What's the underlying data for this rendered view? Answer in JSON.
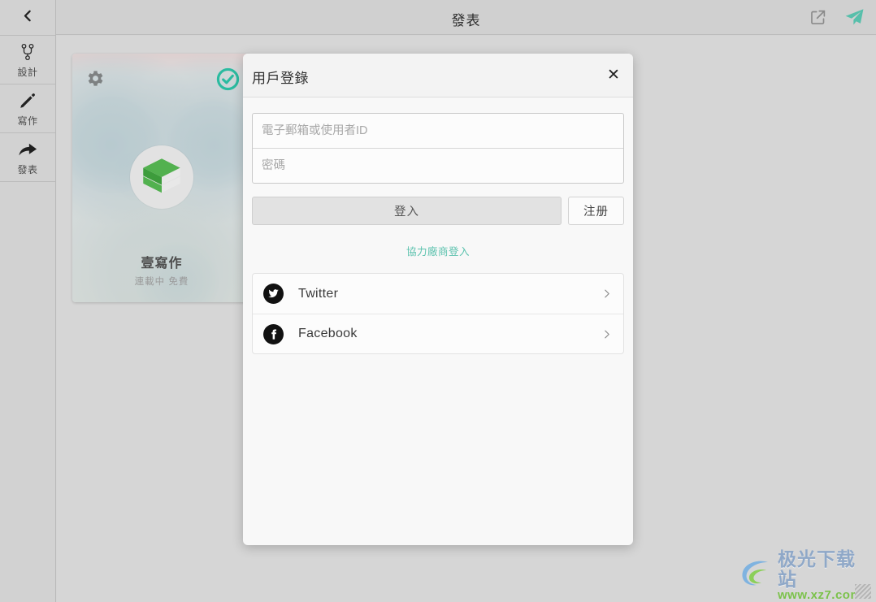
{
  "app": {
    "background_color": "#d6d6d6",
    "accent_color": "#5cc2ae"
  },
  "sidebar": {
    "back_icon": "chevron-left-icon",
    "items": [
      {
        "label": "設計",
        "icon": "branch-icon"
      },
      {
        "label": "寫作",
        "icon": "pencil-icon"
      },
      {
        "label": "發表",
        "icon": "share-arrow-icon"
      }
    ]
  },
  "topbar": {
    "title": "發表",
    "actions": [
      {
        "name": "export-icon",
        "label": ""
      },
      {
        "name": "send-icon",
        "label": ""
      }
    ]
  },
  "book_card": {
    "title": "壹寫作",
    "subtitle": "連載中 免費",
    "gear_icon": "gear-icon",
    "status_icon": "check-circle-icon",
    "logo_icon": "green-book-logo",
    "logo_color": "#4caf50",
    "status_color": "#2bbba0"
  },
  "dialog": {
    "title": "用戶登錄",
    "close_label": "✕",
    "fields": {
      "account_placeholder": "電子郵箱或使用者ID",
      "account_value": "",
      "password_placeholder": "密碼",
      "password_value": ""
    },
    "login_button": "登入",
    "register_button": "注册",
    "third_party_link": "協力廠商登入",
    "providers": [
      {
        "name": "Twitter",
        "icon": "twitter-icon"
      },
      {
        "name": "Facebook",
        "icon": "facebook-icon"
      }
    ]
  },
  "watermark": {
    "title": "极光下载站",
    "url": "www.xz7.com"
  }
}
